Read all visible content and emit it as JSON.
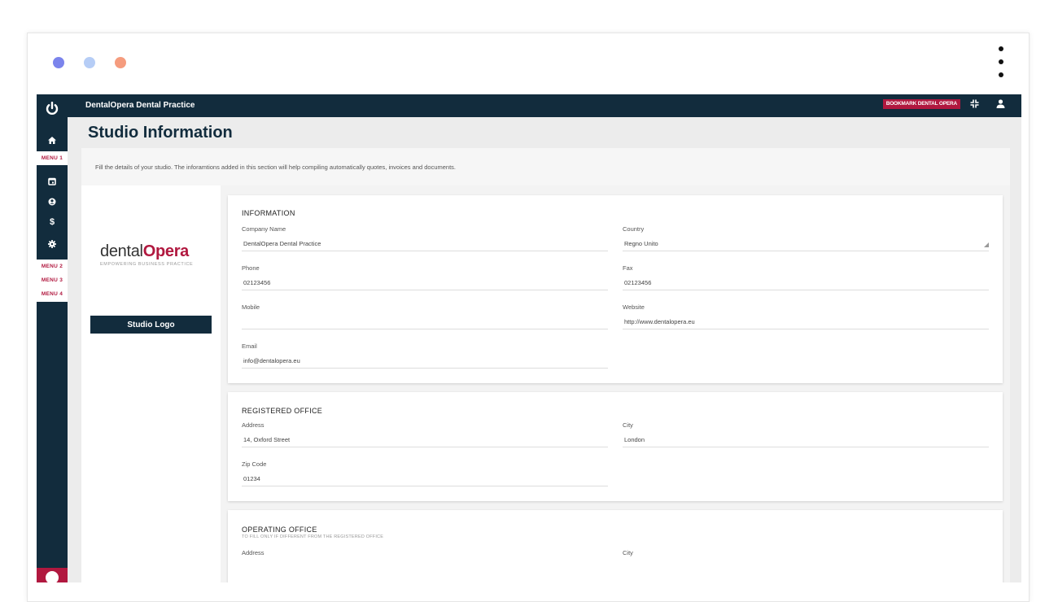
{
  "browser": {
    "dots": [
      "#7b84ec",
      "#b6cdf6",
      "#f59c7e"
    ]
  },
  "sidebar": {
    "menus": [
      "MENU 1",
      "MENU 2",
      "MENU 3",
      "MENU 4"
    ],
    "icons": [
      "power-icon",
      "home-icon",
      "calendar-icon",
      "user-circle-icon",
      "dollar-icon",
      "gear-icon"
    ]
  },
  "topbar": {
    "title": "DentalOpera Dental Practice",
    "bookmark": "BOOKMARK DENTAL OPERA"
  },
  "page": {
    "title": "Studio Information",
    "intro": "Fill the details of your studio. The inforamtions added in this section will help compiling automatically quotes, invoices and documents."
  },
  "logo": {
    "brand_light": "dental",
    "brand_bold": "Opera",
    "tagline": "EMPOWERING BUSINESS PRACTICE",
    "button": "Studio Logo"
  },
  "information": {
    "heading": "INFORMATION",
    "company_label": "Company Name",
    "company_value": "DentalOpera Dental Practice",
    "country_label": "Country",
    "country_value": "Regno Unito",
    "phone_label": "Phone",
    "phone_value": "02123456",
    "fax_label": "Fax",
    "fax_value": "02123456",
    "mobile_label": "Mobile",
    "mobile_value": "",
    "website_label": "Website",
    "website_value": "http://www.dentalopera.eu",
    "email_label": "Email",
    "email_value": "info@dentalopera.eu"
  },
  "registered": {
    "heading": "REGISTERED OFFICE",
    "address_label": "Address",
    "address_value": "14, Oxford Street",
    "city_label": "City",
    "city_value": "London",
    "zip_label": "Zip Code",
    "zip_value": "01234"
  },
  "operating": {
    "heading": "OPERATING OFFICE",
    "sub": "TO FILL ONLY IF DIFFERENT FROM THE REGISTERED OFFICE",
    "address_label": "Address",
    "city_label": "City"
  },
  "colors": {
    "navy": "#122c3d",
    "accent": "#b1183f"
  }
}
